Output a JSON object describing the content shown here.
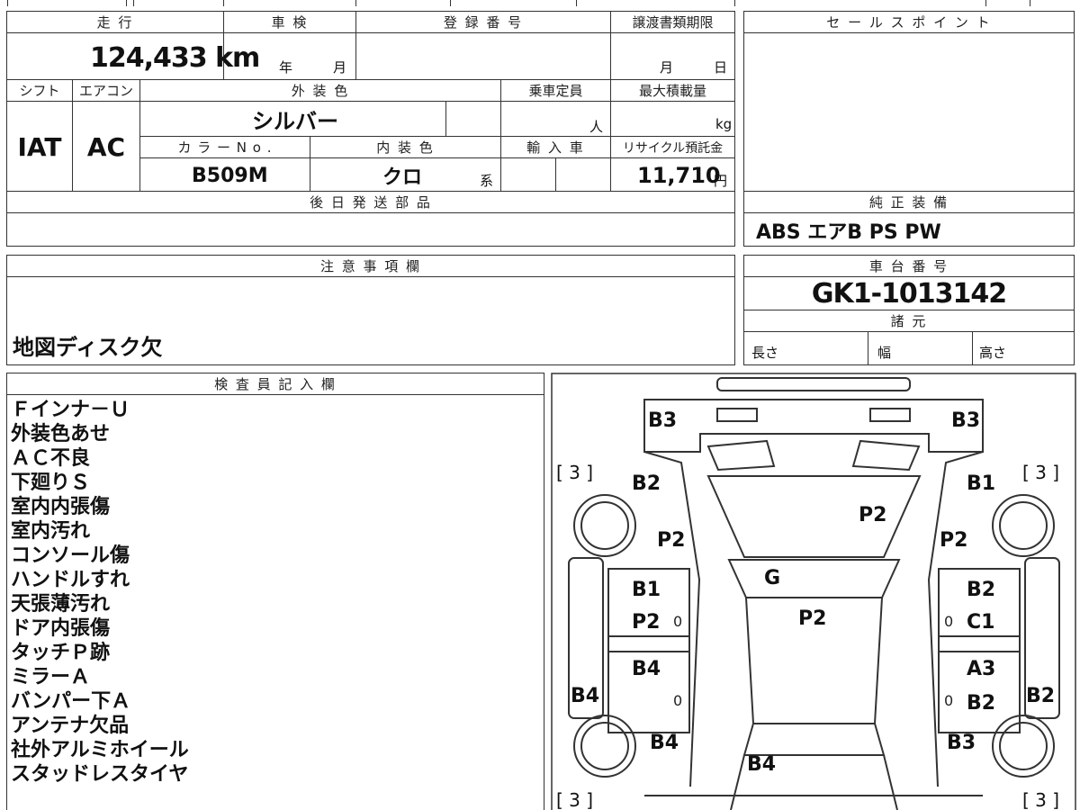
{
  "info": {
    "mileage_header": "走 行",
    "mileage_value": "124,433 km",
    "shaken_header": "車 検",
    "shaken_year": "年",
    "shaken_month": "月",
    "registration_header": "登 録 番 号",
    "transfer_header": "譲渡書類期限",
    "transfer_month": "月",
    "transfer_day": "日",
    "shift_header": "シフト",
    "shift_value": "IAT",
    "aircon_header": "エアコン",
    "aircon_value": "AC",
    "exterior_header": "外 装 色",
    "exterior_value": "シルバー",
    "capacity_header": "乗車定員",
    "capacity_unit": "人",
    "load_header": "最大積載量",
    "load_unit": "kg",
    "color_no_header": "カ ラ ー N o .",
    "color_no_value": "B509M",
    "interior_header": "内 装 色",
    "interior_value": "クロ",
    "interior_suffix": "系",
    "import_header": "輸 入 車",
    "recycle_header": "リサイクル預託金",
    "recycle_value": "11,710",
    "recycle_unit": "円",
    "later_parts_header": "後 日 発 送 部 品"
  },
  "right": {
    "sales_point_header": "セ ー ル ス ポ イ ン ト",
    "equipment_header": "純 正 装 備",
    "equipment_value": "ABS エアB PS PW",
    "chassis_header": "車 台 番 号",
    "chassis_value": "GK1-1013142",
    "specs_header": "諸 元",
    "length_label": "長さ",
    "width_label": "幅",
    "height_label": "高さ"
  },
  "notes": {
    "header": "注 意 事 項 欄",
    "value": "地図ディスク欠"
  },
  "inspector": {
    "header": "検 査 員 記 入 欄",
    "lines": [
      "Ｆインナ－Ｕ",
      "外装色あせ",
      "ＡＣ不良",
      "下廻りＳ",
      "室内内張傷",
      "室内汚れ",
      "コンソール傷",
      "ハンドルすれ",
      "天張薄汚れ",
      "ドア内張傷",
      "タッチＰ跡",
      "ミラーＡ",
      "バンパー下Ａ",
      "アンテナ欠品",
      "社外アルミホイール",
      "スタッドレスタイヤ"
    ]
  },
  "diagram": {
    "labels": {
      "b3_left": "B3",
      "b3_right": "B3",
      "b2_front_left": "B2",
      "b1_front_right": "B1",
      "p2_hood": "P2",
      "p2_left_fender": "P2",
      "p2_right_fender": "P2",
      "g_windshield": "G",
      "p2_roof": "P2",
      "b1_front_door_left": "B1",
      "p2_front_door_left": "P2",
      "b2_front_door_right": "B2",
      "c1_front_door_right": "C1",
      "b4_rear_door_left": "B4",
      "a3_rear_door_right": "A3",
      "b2_rear_door_right": "B2",
      "b4_left_sill": "B4",
      "b2_right_sill": "B2",
      "b4_rear_left": "B4",
      "b3_rear_right": "B3",
      "b4_trunk": "B4",
      "zero_1": "0",
      "zero_2": "0",
      "zero_3": "0",
      "zero_4": "0"
    },
    "brackets": {
      "top_left": "[ 3 ]",
      "top_right": "[ 3 ]",
      "bottom_left": "[ 3 ]",
      "bottom_right": "[ 3 ]"
    }
  }
}
